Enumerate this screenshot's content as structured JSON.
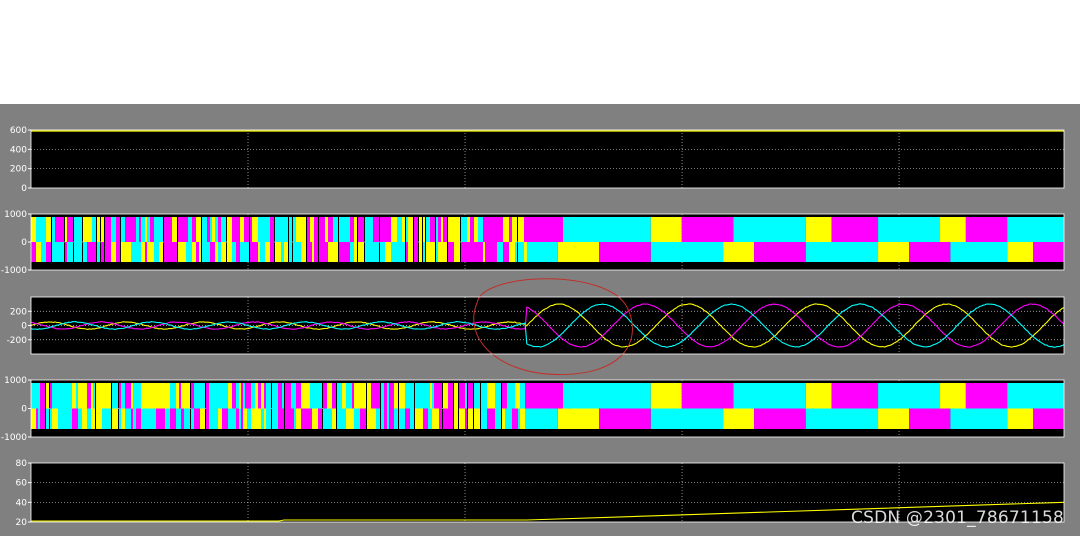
{
  "scope": {
    "background": "#808080",
    "plot_background": "#000000",
    "grid_color": "#c8c8c8",
    "colors": {
      "yellow": "#ffff00",
      "magenta": "#ff00ff",
      "cyan": "#00ffff"
    }
  },
  "chart_data": [
    {
      "type": "line",
      "title": "",
      "ylim": [
        0,
        600
      ],
      "yticks": [
        "600",
        "400",
        "200",
        "0"
      ],
      "grid": true,
      "description_series": [
        {
          "color": "#ffff00",
          "x": [
            0,
            1
          ],
          "y": [
            600,
            600
          ]
        }
      ]
    },
    {
      "type": "line",
      "title": "",
      "ylim": [
        -1000,
        1000
      ],
      "yticks": [
        "1000",
        "0",
        "-1000"
      ],
      "grid": true,
      "pwm_switch_fraction": 0.48
    },
    {
      "type": "line",
      "title": "",
      "ylim": [
        -400,
        400
      ],
      "yticks": [
        "200",
        "0",
        "-200"
      ],
      "grid": true,
      "series": [
        {
          "color": "#ffff00",
          "amplitude_before": 50,
          "amplitude_after": 300,
          "phase_deg": 0
        },
        {
          "color": "#ff00ff",
          "amplitude_before": 50,
          "amplitude_after": 300,
          "phase_deg": 120
        },
        {
          "color": "#00ffff",
          "amplitude_before": 50,
          "amplitude_after": 300,
          "phase_deg": 240
        }
      ],
      "step_fraction": 0.48
    },
    {
      "type": "line",
      "title": "",
      "ylim": [
        -1000,
        1000
      ],
      "yticks": [
        "1000",
        "0",
        "-1000"
      ],
      "grid": true,
      "pwm_switch_fraction": 0.48
    },
    {
      "type": "line",
      "title": "",
      "ylim": [
        20,
        80
      ],
      "yticks": [
        "80",
        "60",
        "40",
        "20"
      ],
      "grid": true,
      "series": [
        {
          "color": "#ffff00",
          "x": [
            0,
            0.24,
            0.245,
            0.48,
            1.0
          ],
          "y": [
            21,
            21,
            22,
            22,
            40
          ]
        }
      ]
    }
  ],
  "watermark": "CSDN @2301_78671158"
}
